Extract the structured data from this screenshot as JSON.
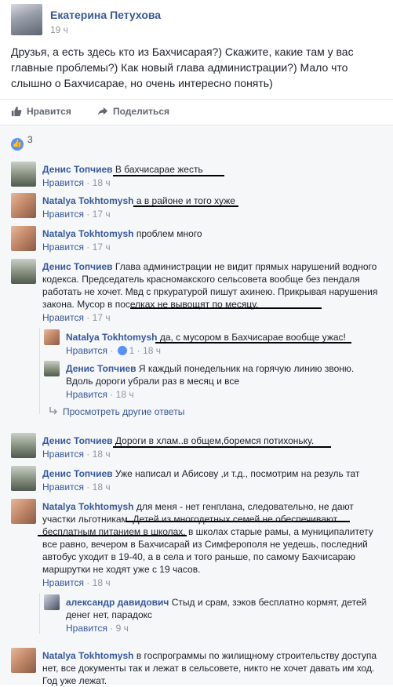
{
  "post": {
    "author": "Екатерина Петухова",
    "time": "19 ч",
    "text": "Друзья, а есть здесь кто из Бахчисарая?) Скажите, какие там у вас главные проблемы?) Как новый глава администрации?) Мало что слышно о Бахчисарае, но очень интересно понять)"
  },
  "actions": {
    "like": "Нравится",
    "share": "Поделиться"
  },
  "likes_count": "3",
  "comments": [
    {
      "author": "Денис Топчиев",
      "text": "В бахчисарае жесть",
      "like": "Нравится",
      "sep": "·",
      "time": "18 ч"
    },
    {
      "author": "Natalya Tokhtomysh",
      "text": "а в районе и того хуже",
      "like": "Нравится",
      "sep": "·",
      "time": "17 ч"
    },
    {
      "author": "Natalya Tokhtomysh",
      "text": "проблем много",
      "like": "Нравится",
      "sep": "·",
      "time": "17 ч"
    },
    {
      "author": "Денис Топчиев",
      "text": "Глава администрации не видит прямых нарушений водного кодекса. Председатель красномакского сельсовета вообще без пендаля работать не хочет. Мвд с пркуратурой пишут ахинею. Прикрывая нарушения закона. Мусор в поселках не вывощят по месяцу.",
      "like": "Нравится",
      "sep": "·",
      "time": "17 ч"
    },
    {
      "author": "Natalya Tokhtomysh",
      "text": "да, с мусором в Бахчисарае вообще ужас!",
      "like": "Нравится",
      "sep": "·",
      "reacts": "1",
      "time": "18 ч"
    },
    {
      "author": "Денис Топчиев",
      "text": "Я каждый понедельник на горячую линию звоню. Вдоль дороги убрали раз в месяц и все",
      "like": "Нравится",
      "sep": "·",
      "time": "18 ч"
    },
    {
      "author": "Денис Топчиев",
      "text": "Дороги в хлам..в общем,боремся потихоньку.",
      "like": "Нравится",
      "sep": "·",
      "time": "18 ч"
    },
    {
      "author": "Денис Топчиев",
      "text": "Уже написал и Абисову ,и т.д., посмотрим на резуль тат",
      "like": "Нравится",
      "sep": "·",
      "time": "18 ч"
    },
    {
      "author": "Natalya Tokhtomysh",
      "text": "для меня - нет генплана, следовательно, не дают участки льготникам. Детей из многодетных семей не обеспечивают бесплатным питанием в школах, в школах старые рамы, а муниципалитету все равно, вечером в Бахчисарай из Симферополя не уедешь, последний автобус уходит в 19-40, а в села и того раньше, по самому Бахчисараю маршрутки не ходят уже с 19 часов.",
      "like": "Нравится",
      "sep": "·",
      "time": "18 ч"
    },
    {
      "author": "александр давидович",
      "text": "Стыд и срам, зэков бесплатно кормят, детей денег нет, парадокс",
      "like": "Нравится",
      "sep": "·",
      "time": "9 ч"
    },
    {
      "author": "Natalya Tokhtomysh",
      "text": "в госпрограммы по жилищному строительству доступа нет, все документы так и лежат в сельсовете, никто не хочет давать им ход. Год уже лежат.",
      "like": "",
      "sep": "",
      "time": ""
    }
  ],
  "more_replies": "Просмотреть другие ответы",
  "colors": {
    "link": "#365899",
    "background": "#f6f7f9",
    "like_blue": "#5890ff"
  },
  "icons": [
    "like-icon",
    "share-icon",
    "reply-arrow-icon"
  ]
}
